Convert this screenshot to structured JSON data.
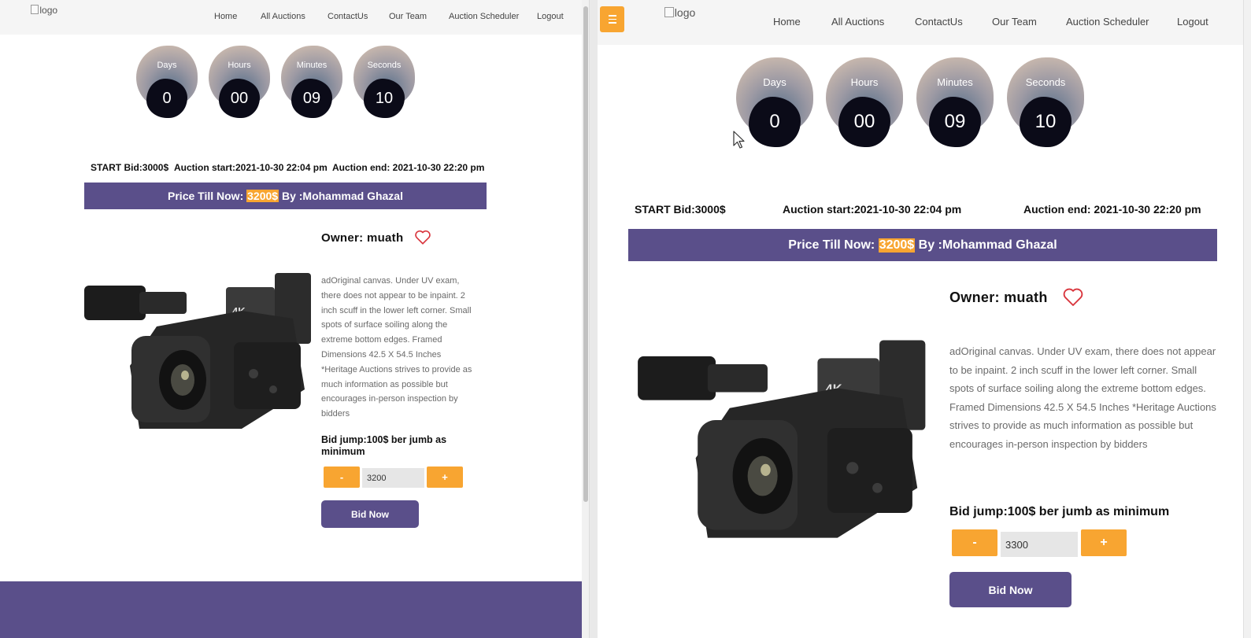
{
  "logo_alt": "logo",
  "nav": [
    "Home",
    "All Auctions",
    "ContactUs",
    "Our Team",
    "Auction Scheduler",
    "Logout"
  ],
  "timer": {
    "labels": [
      "Days",
      "Hours",
      "Minutes",
      "Seconds"
    ],
    "values": [
      "0",
      "00",
      "09",
      "10"
    ]
  },
  "auction": {
    "start_bid": "START Bid:3000$",
    "start": "Auction start:2021-10-30 22:04 pm",
    "end": "Auction end: 2021-10-30 22:20 pm",
    "price_prefix": "Price Till Now: ",
    "price_value": "3200$",
    "price_suffix": " By :Mohammad Ghazal",
    "owner": "Owner: muath",
    "description": "adOriginal canvas. Under UV exam, there does not appear to be inpaint. 2 inch scuff in the lower left corner. Small spots of surface soiling along the extreme bottom edges. Framed Dimensions 42.5 X 54.5 Inches *Heritage Auctions strives to provide as much information as possible but encourages in-person inspection by bidders",
    "bid_jump": "Bid jump:100$ ber jumb as minimum",
    "minus": "-",
    "plus": "+",
    "bid_now": "Bid Now"
  },
  "left_window": {
    "bid_input_value": "3200"
  },
  "right_window": {
    "bid_input_value": "3300"
  },
  "colors": {
    "accent_orange": "#f8a531",
    "brand_purple": "#5a4f8a",
    "heart_red": "#d9363e",
    "timer_dark": "#0b0b18"
  },
  "icons": {
    "heart": "heart-icon",
    "menu": "hamburger-icon",
    "cursor": "mouse-cursor-icon"
  }
}
